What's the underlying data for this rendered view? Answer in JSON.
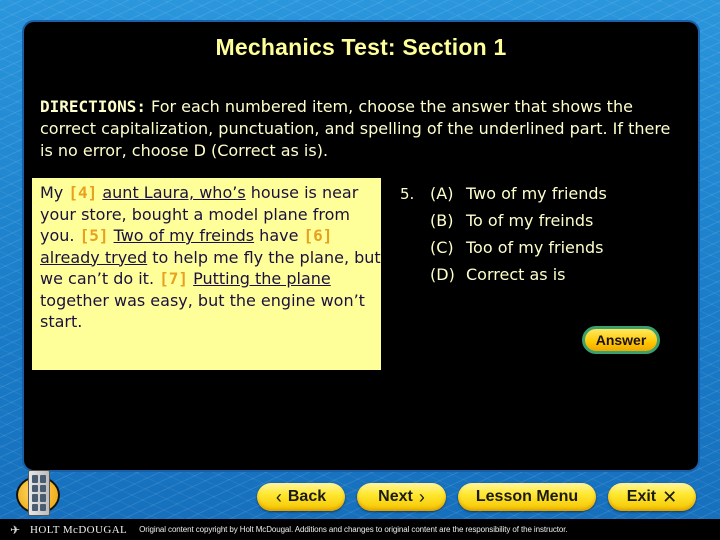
{
  "title": "Mechanics Test: Section 1",
  "directions": {
    "lead": "DIRECTIONS:",
    "text": " For each numbered item, choose the answer that shows the correct capitalization, punctuation, and spelling of the underlined part. If there is no error, choose D (Correct as is)."
  },
  "passage": {
    "segments": [
      {
        "type": "text",
        "text": "My "
      },
      {
        "type": "num",
        "text": "[4]"
      },
      {
        "type": "text",
        "text": " "
      },
      {
        "type": "ul",
        "text": "aunt Laura, who’s"
      },
      {
        "type": "text",
        "text": " house is near your store, bought a model plane from you. "
      },
      {
        "type": "num",
        "text": "[5]"
      },
      {
        "type": "text",
        "text": " "
      },
      {
        "type": "ul",
        "text": "Two of my freinds"
      },
      {
        "type": "text",
        "text": " have "
      },
      {
        "type": "num",
        "text": "[6]"
      },
      {
        "type": "text",
        "text": " "
      },
      {
        "type": "ul",
        "text": "already tryed"
      },
      {
        "type": "text",
        "text": " to help me fly the plane, but we can’t do it. "
      },
      {
        "type": "num",
        "text": "[7]"
      },
      {
        "type": "text",
        "text": " "
      },
      {
        "type": "ul",
        "text": "Putting the plane"
      },
      {
        "type": "text",
        "text": " together was easy, but the engine won’t start."
      }
    ]
  },
  "question": {
    "number": "5.",
    "options": [
      {
        "letter": "(A)",
        "text": "Two of my friends"
      },
      {
        "letter": "(B)",
        "text": "To of my freinds"
      },
      {
        "letter": "(C)",
        "text": "Too of my friends"
      },
      {
        "letter": "(D)",
        "text": "Correct as is"
      }
    ]
  },
  "answer_button": "Answer",
  "nav": {
    "back": {
      "label": "Back",
      "icon": "‹"
    },
    "next": {
      "label": "Next",
      "icon": "›"
    },
    "lesson_menu": {
      "label": "Lesson Menu"
    },
    "exit": {
      "label": "Exit",
      "icon": "✕"
    }
  },
  "footer": {
    "brand": "HOLT McDOUGAL",
    "copyright": "Original content copyright by Holt McDougal. Additions and changes to original content are the responsibility of the instructor."
  },
  "colors": {
    "title": "#ffff99",
    "passage_bg": "#ffff99",
    "item_number": "#e8a020",
    "button_yellow": "#ffe830",
    "background_blue": "#1e88d4"
  }
}
